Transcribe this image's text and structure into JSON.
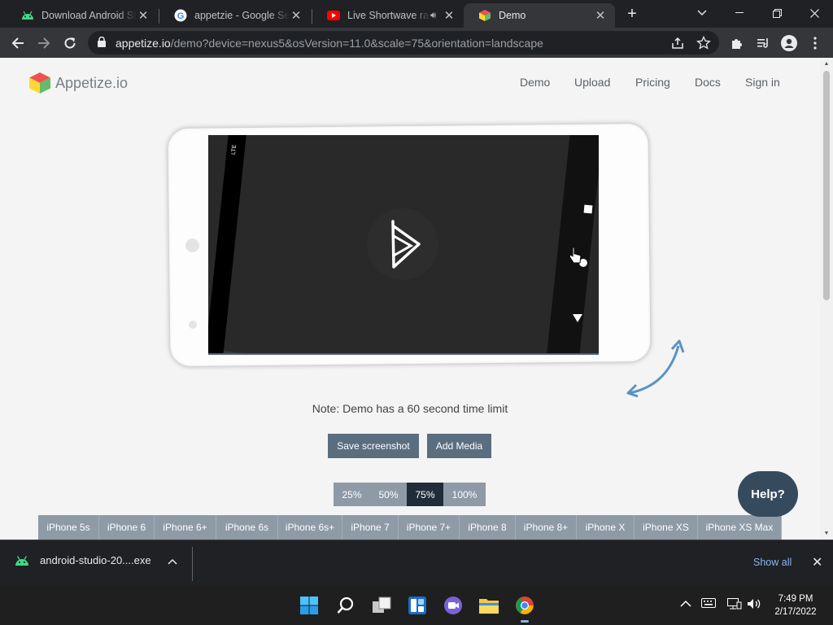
{
  "browser": {
    "tabs": [
      {
        "title": "Download Android Studio",
        "icon": "android-icon",
        "active": false
      },
      {
        "title": "appetzie - Google Search",
        "icon": "google-icon",
        "active": false
      },
      {
        "title": "Live Shortwave radio",
        "icon": "youtube-icon",
        "active": false,
        "audio": true
      },
      {
        "title": "Demo",
        "icon": "appetize-cube-icon",
        "active": true
      }
    ],
    "url_host": "appetize.io",
    "url_path": "/demo?device=nexus5&osVersion=11.0&scale=75&orientation=landscape"
  },
  "page": {
    "logo_text": "Appetize.io",
    "nav": [
      "Demo",
      "Upload",
      "Pricing",
      "Docs",
      "Sign in"
    ],
    "note": "Note: Demo has a 60 second time limit",
    "save_screenshot_label": "Save screenshot",
    "add_media_label": "Add Media",
    "scales": [
      {
        "label": "25%",
        "selected": false
      },
      {
        "label": "50%",
        "selected": false
      },
      {
        "label": "75%",
        "selected": true
      },
      {
        "label": "100%",
        "selected": false
      }
    ],
    "devices": [
      "iPhone 5s",
      "iPhone 6",
      "iPhone 6+",
      "iPhone 6s",
      "iPhone 6s+",
      "iPhone 7",
      "iPhone 7+",
      "iPhone 8",
      "iPhone 8+",
      "iPhone X",
      "iPhone XS",
      "iPhone XS Max"
    ],
    "help_label": "Help?",
    "status_bar_text": "LTE"
  },
  "downloads": {
    "file": "android-studio-20....exe",
    "show_all": "Show all"
  },
  "taskbar": {
    "time": "7:49 PM",
    "date": "2/17/2022"
  },
  "colors": {
    "button": "#5a6e80",
    "help_bubble": "#364a5e",
    "selected_scale": "#1f2d3a",
    "link_blue": "#8ab4f8",
    "rotate_arrow": "#5b92c4"
  }
}
